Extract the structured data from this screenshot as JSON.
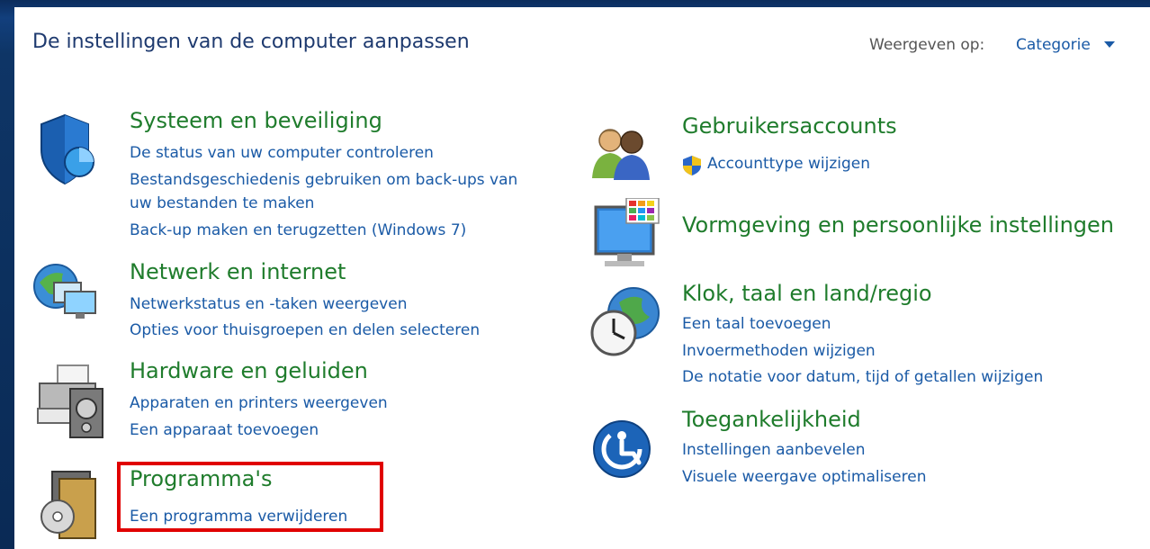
{
  "header": {
    "title": "De instellingen van de computer aanpassen",
    "view_by_label": "Weergeven op:",
    "view_by_value": "Categorie"
  },
  "left": [
    {
      "title": "Systeem en beveiliging",
      "icon": "shield-icon",
      "links": [
        "De status van uw computer controleren",
        "Bestandsgeschiedenis gebruiken om back-ups van",
        "uw bestanden te maken",
        "Back-up maken en terugzetten (Windows 7)"
      ]
    },
    {
      "title": "Netwerk en internet",
      "icon": "network-icon",
      "links": [
        "Netwerkstatus en -taken weergeven",
        "Opties voor thuisgroepen en delen selecteren"
      ]
    },
    {
      "title": "Hardware en geluiden",
      "icon": "printer-icon",
      "links": [
        "Apparaten en printers weergeven",
        "Een apparaat toevoegen"
      ]
    },
    {
      "title": "Programma's",
      "icon": "programs-icon",
      "links": [
        "Een programma verwijderen"
      ]
    }
  ],
  "right": [
    {
      "title": "Gebruikersaccounts",
      "icon": "users-icon",
      "links": [
        "Accounttype wijzigen"
      ]
    },
    {
      "title": "Vormgeving en persoonlijke instellingen",
      "icon": "monitor-icon",
      "links": []
    },
    {
      "title": "Klok, taal en land/regio",
      "icon": "clock-globe-icon",
      "links": [
        "Een taal toevoegen",
        "Invoermethoden wijzigen",
        "De notatie voor datum, tijd of getallen wijzigen"
      ]
    },
    {
      "title": "Toegankelijkheid",
      "icon": "accessibility-icon",
      "links": [
        "Instellingen aanbevelen",
        "Visuele weergave optimaliseren"
      ]
    }
  ],
  "colors": {
    "heading": "#1f7c2c",
    "link": "#1a5aa6",
    "highlight": "#e00000"
  }
}
